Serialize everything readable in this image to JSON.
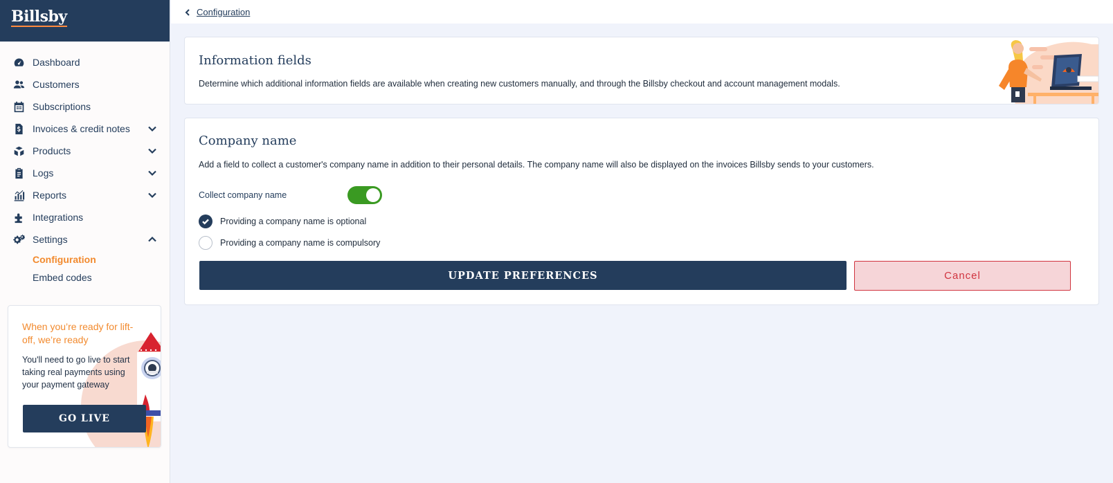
{
  "brand": {
    "name": "Billsby"
  },
  "sidebar": {
    "items": [
      {
        "label": "Dashboard",
        "icon": "dashboard-icon"
      },
      {
        "label": "Customers",
        "icon": "users-icon"
      },
      {
        "label": "Subscriptions",
        "icon": "calendar-icon"
      },
      {
        "label": "Invoices & credit notes",
        "icon": "invoice-icon",
        "chevron": "down"
      },
      {
        "label": "Products",
        "icon": "boxes-icon",
        "chevron": "down"
      },
      {
        "label": "Logs",
        "icon": "clipboard-icon",
        "chevron": "down"
      },
      {
        "label": "Reports",
        "icon": "chart-icon",
        "chevron": "down"
      },
      {
        "label": "Integrations",
        "icon": "puzzle-icon"
      },
      {
        "label": "Settings",
        "icon": "gears-icon",
        "chevron": "up"
      }
    ],
    "settings_sub": [
      {
        "label": "Configuration",
        "active": true
      },
      {
        "label": "Embed codes",
        "active": false
      }
    ],
    "promo": {
      "title": "When you’re ready for lift-off, we’re ready",
      "text": "You'll need to go live to start taking real payments using your payment gateway",
      "button": "GO LIVE"
    }
  },
  "breadcrumb": {
    "back_label": "Configuration"
  },
  "info_card": {
    "title": "Information fields",
    "description": "Determine which additional information fields are available when creating new customers manually, and through the Billsby checkout and account management modals."
  },
  "company_card": {
    "title": "Company name",
    "description": "Add a field to collect a customer's company name in addition to their personal details. The company name will also be displayed on the invoices Billsby sends to your customers.",
    "toggle_label": "Collect company name",
    "toggle_on": true,
    "options": [
      {
        "label": "Providing a company name is optional",
        "selected": true
      },
      {
        "label": "Providing a company name is compulsory",
        "selected": false
      }
    ],
    "update_button": "UPDATE PREFERENCES",
    "cancel_button": "Cancel"
  },
  "colors": {
    "navy": "#243d5c",
    "accent_orange": "#f28a2e",
    "toggle_green": "#3a9a22",
    "cancel_red": "#d0343f",
    "page_bg": "#f0f3fb"
  }
}
